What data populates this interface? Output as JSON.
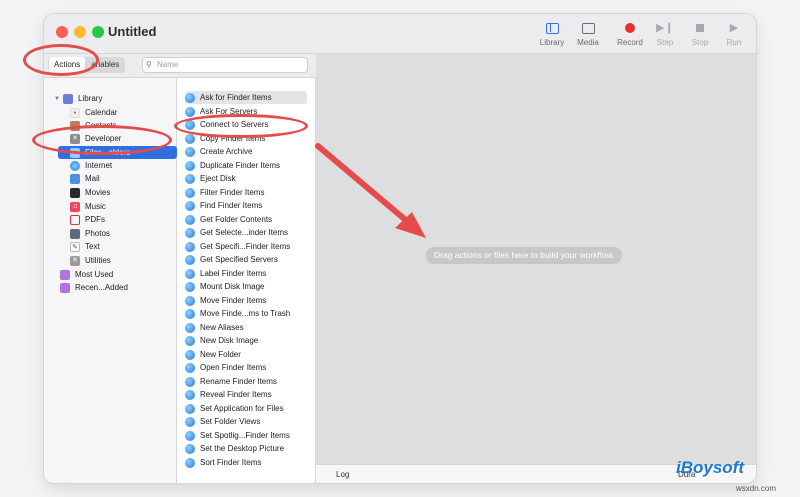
{
  "window": {
    "title": "Untitled"
  },
  "toolbar": {
    "library": "Library",
    "media": "Media",
    "record": "Record",
    "step": "Step",
    "stop": "Stop",
    "run": "Run"
  },
  "search": {
    "tab_actions": "Actions",
    "tab_variables": "ariables",
    "placeholder": "Name"
  },
  "library": {
    "root": "Library",
    "items": [
      "Calendar",
      "Contacts",
      "Developer",
      "Files...olders",
      "Fonts",
      "Internet",
      "Mail",
      "Movies",
      "Music",
      "PDFs",
      "Photos",
      "Text",
      "Utilities"
    ],
    "smart_groups": [
      "Most Used",
      "Recen...Added"
    ]
  },
  "actions": {
    "items": [
      "Ask for Finder Items",
      "Ask For Servers",
      "Connect to Servers",
      "Copy Finder Items",
      "Create Archive",
      "Duplicate Finder Items",
      "Eject Disk",
      "Filter Finder Items",
      "Find Finder Items",
      "Get Folder Contents",
      "Get Selecte...inder Items",
      "Get Specifi...Finder Items",
      "Get Specified Servers",
      "Label Finder Items",
      "Mount Disk Image",
      "Move Finder Items",
      "Move Finde...ms to Trash",
      "New Aliases",
      "New Disk Image",
      "New Folder",
      "Open Finder Items",
      "Rename Finder Items",
      "Reveal Finder Items",
      "Set Application for Files",
      "Set Folder Views",
      "Set Spotlig...Finder Items",
      "Set the Desktop Picture",
      "Sort Finder Items"
    ]
  },
  "workflow": {
    "drop_hint": "Drag actions or files here to build your workflow.",
    "log_label": "Log",
    "duration_label": "Dura"
  },
  "watermark": {
    "brand": "iBoysoft",
    "site": "wsxdn.com"
  },
  "colors": {
    "annotation": "#e54b4b",
    "selection": "#2f6fe0",
    "record": "#e6302b"
  }
}
